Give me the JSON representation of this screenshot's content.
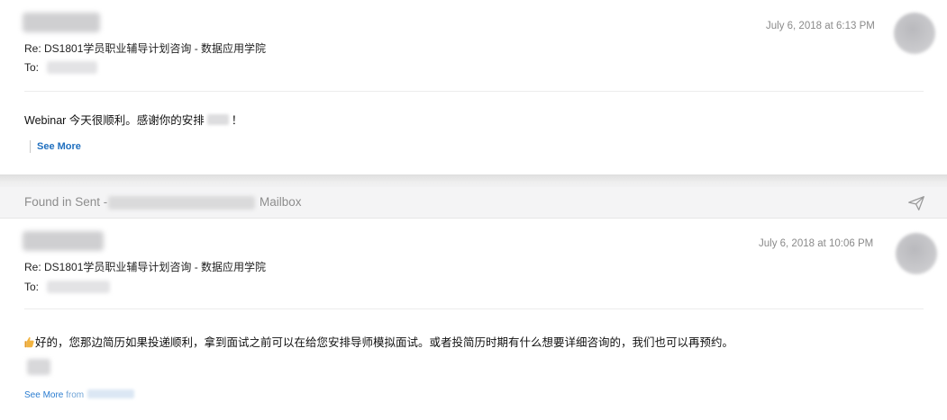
{
  "message1": {
    "subject": "Re: DS1801学员职业辅导计划咨询 - 数据应用学院",
    "to_label": "To:",
    "date": "July 6, 2018 at 6:13 PM",
    "body_prefix": "Webinar 今天很顺利。感谢你的安排",
    "body_suffix": "！",
    "see_more": "See More"
  },
  "found_bar": {
    "prefix": "Found in Sent -",
    "suffix": "Mailbox",
    "icon": "paper-plane-icon"
  },
  "message2": {
    "subject": "Re: DS1801学员职业辅导计划咨询 - 数据应用学院",
    "to_label": "To:",
    "date": "July 6, 2018 at 10:06 PM",
    "body": "好的，您那边简历如果投递顺利，拿到面试之前可以在给您安排导师模拟面试。或者投简历时期有什么想要详细咨询的，我们也可以再预约。",
    "body_icon": "thumbs-up-icon",
    "see_more": "See More",
    "see_more_from": "from"
  },
  "colors": {
    "link": "#1f6fbf",
    "muted": "#8a8a8a",
    "background": "#f1f1f2"
  }
}
